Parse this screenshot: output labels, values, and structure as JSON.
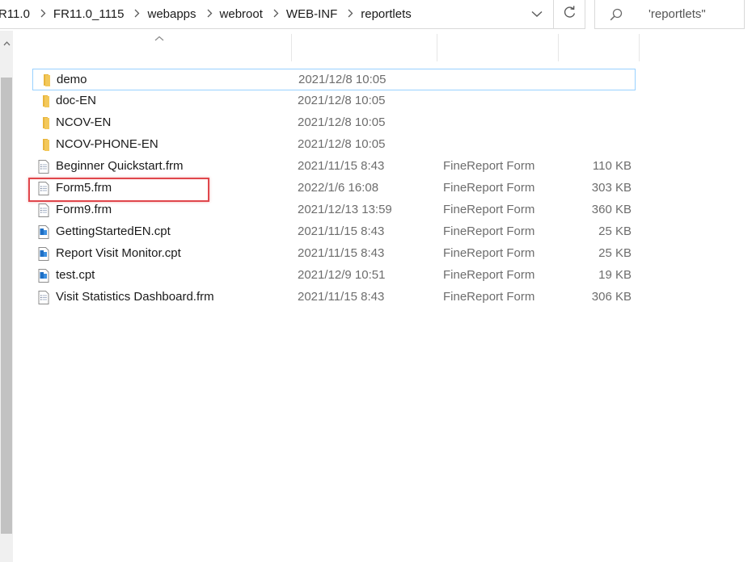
{
  "address_bar": {
    "crumbs": [
      "R11.0",
      "FR11.0_1115",
      "webapps",
      "webroot",
      "WEB-INF",
      "reportlets"
    ]
  },
  "search": {
    "text": "'reportlets\""
  },
  "icons": {
    "folder_color": "#e8b53d",
    "report_color": "#1e6fc5"
  },
  "files": [
    {
      "name": "demo",
      "date": "2021/12/8 10:05",
      "type": "",
      "size": "",
      "icon": "folder-icon",
      "selected": true
    },
    {
      "name": "doc-EN",
      "date": "2021/12/8 10:05",
      "type": "",
      "size": "",
      "icon": "folder-icon",
      "selected": false
    },
    {
      "name": "NCOV-EN",
      "date": "2021/12/8 10:05",
      "type": "",
      "size": "",
      "icon": "folder-icon",
      "selected": false
    },
    {
      "name": "NCOV-PHONE-EN",
      "date": "2021/12/8 10:05",
      "type": "",
      "size": "",
      "icon": "folder-icon",
      "selected": false
    },
    {
      "name": "Beginner Quickstart.frm",
      "date": "2021/11/15 8:43",
      "type": "FineReport Form",
      "size": "110 KB",
      "icon": "frm-file-icon",
      "selected": false
    },
    {
      "name": "Form5.frm",
      "date": "2022/1/6 16:08",
      "type": "FineReport Form",
      "size": "303 KB",
      "icon": "frm-file-icon",
      "selected": false
    },
    {
      "name": "Form9.frm",
      "date": "2021/12/13 13:59",
      "type": "FineReport Form",
      "size": "360 KB",
      "icon": "frm-file-icon",
      "selected": false
    },
    {
      "name": "GettingStartedEN.cpt",
      "date": "2021/11/15 8:43",
      "type": "FineReport Form",
      "size": "25 KB",
      "icon": "cpt-file-icon",
      "selected": false
    },
    {
      "name": "Report Visit Monitor.cpt",
      "date": "2021/11/15 8:43",
      "type": "FineReport Form",
      "size": "25 KB",
      "icon": "cpt-file-icon",
      "selected": false
    },
    {
      "name": "test.cpt",
      "date": "2021/12/9 10:51",
      "type": "FineReport Form",
      "size": "19 KB",
      "icon": "cpt-file-icon",
      "selected": false
    },
    {
      "name": "Visit Statistics Dashboard.frm",
      "date": "2021/11/15 8:43",
      "type": "FineReport Form",
      "size": "306 KB",
      "icon": "frm-file-icon",
      "selected": false
    }
  ]
}
